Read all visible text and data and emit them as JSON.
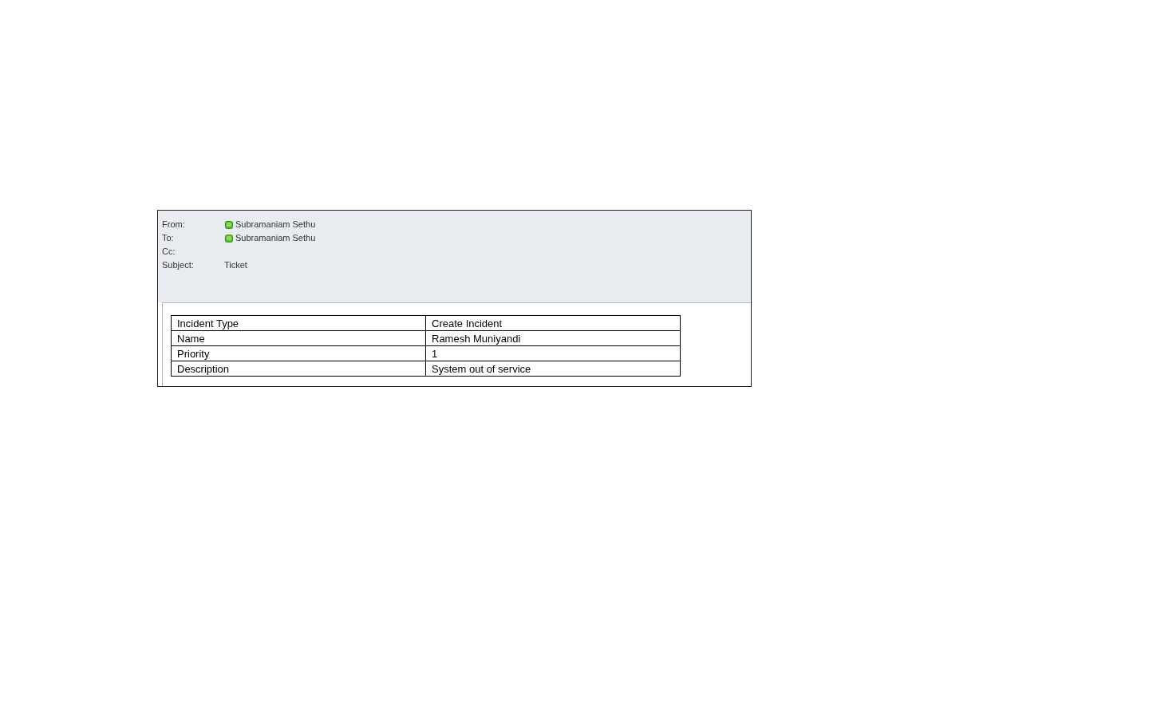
{
  "header": {
    "fields": [
      {
        "label": "From:",
        "kind": "contact",
        "value": "Subramaniam Sethu"
      },
      {
        "label": "To:",
        "kind": "contact",
        "value": "Subramaniam Sethu"
      },
      {
        "label": "Cc:",
        "kind": "empty"
      },
      {
        "label": "Subject:",
        "kind": "text",
        "value": "Ticket"
      }
    ]
  },
  "body": {
    "table": {
      "rows": [
        {
          "label": "Incident Type",
          "value": "Create Incident"
        },
        {
          "label": "Name",
          "value": "Ramesh Muniyandi"
        },
        {
          "label": "Priority",
          "value": "1"
        },
        {
          "label": "Description",
          "value": "System out of service"
        }
      ]
    }
  }
}
